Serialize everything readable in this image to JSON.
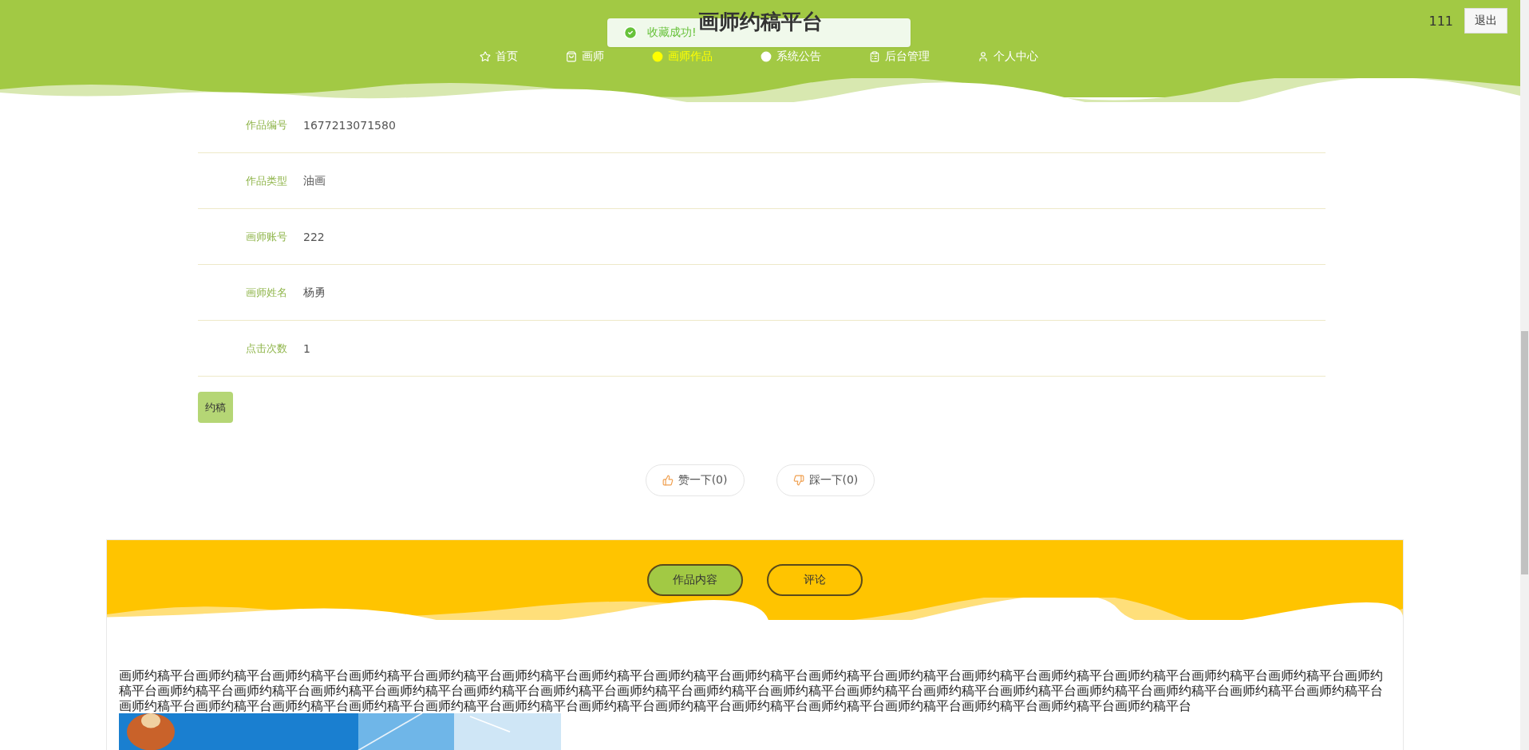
{
  "header": {
    "title": "画师约稿平台",
    "user": "111",
    "logout": "退出",
    "nav": [
      {
        "label": "首页",
        "selected": false
      },
      {
        "label": "画师",
        "selected": false
      },
      {
        "label": "画师作品",
        "selected": true
      },
      {
        "label": "系统公告",
        "selected": false
      },
      {
        "label": "后台管理",
        "selected": false
      },
      {
        "label": "个人中心",
        "selected": false
      }
    ]
  },
  "toast": {
    "message": "收藏成功!"
  },
  "details": [
    {
      "label": "作品编号",
      "value": "1677213071580"
    },
    {
      "label": "作品类型",
      "value": "油画"
    },
    {
      "label": "画师账号",
      "value": "222"
    },
    {
      "label": "画师姓名",
      "value": "杨勇"
    },
    {
      "label": "点击次数",
      "value": "1"
    }
  ],
  "book_button": "约稿",
  "votes": [
    {
      "kind": "like",
      "label": "赞一下(0)"
    },
    {
      "kind": "dislike",
      "label": "踩一下(0)"
    }
  ],
  "tabs": [
    {
      "label": "作品内容",
      "selected": true
    },
    {
      "label": "评论",
      "selected": false
    }
  ],
  "content": {
    "text": "画师约稿平台画师约稿平台画师约稿平台画师约稿平台画师约稿平台画师约稿平台画师约稿平台画师约稿平台画师约稿平台画师约稿平台画师约稿平台画师约稿平台画师约稿平台画师约稿平台画师约稿平台画师约稿平台画师约稿平台画师约稿平台画师约稿平台画师约稿平台画师约稿平台画师约稿平台画师约稿平台画师约稿平台画师约稿平台画师约稿平台画师约稿平台画师约稿平台画师约稿平台画师约稿平台画师约稿平台画师约稿平台画师约稿平台画师约稿平台画师约稿平台画师约稿平台画师约稿平台画师约稿平台画师约稿平台画师约稿平台画师约稿平台画师约稿平台画师约稿平台画师约稿平台画师约稿平台画师约稿平台画师约稿平台"
  }
}
